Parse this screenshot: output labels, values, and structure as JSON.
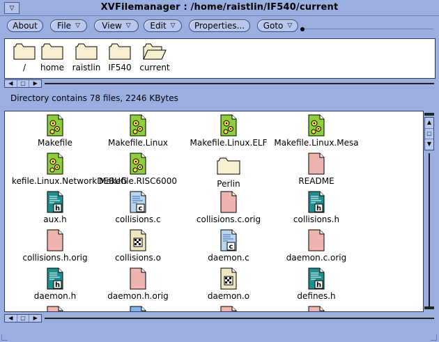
{
  "window": {
    "title": "XVFilemanager : /home/raistlin/IF540/current",
    "menu_glyph": "▽"
  },
  "menubar": [
    {
      "label": "About",
      "has_menu": false
    },
    {
      "label": "File",
      "has_menu": true
    },
    {
      "label": "View",
      "has_menu": true
    },
    {
      "label": "Edit",
      "has_menu": true
    },
    {
      "label": "Properties...",
      "has_menu": false
    },
    {
      "label": "Goto",
      "has_menu": true
    }
  ],
  "path": [
    {
      "label": "/",
      "icon": "folder-icon"
    },
    {
      "label": "home",
      "icon": "folder-icon"
    },
    {
      "label": "raistlin",
      "icon": "folder-icon"
    },
    {
      "label": "IF540",
      "icon": "folder-icon"
    },
    {
      "label": "current",
      "icon": "open-folder-icon"
    }
  ],
  "status": "Directory contains 78 files,   2246 KBytes",
  "files": [
    {
      "name": "Makefile",
      "type": "makefile"
    },
    {
      "name": "Makefile.Linux",
      "type": "makefile"
    },
    {
      "name": "Makefile.Linux.ELF",
      "type": "makefile"
    },
    {
      "name": "Makefile.Linux.Mesa",
      "type": "makefile"
    },
    {
      "name": "kefile.Linux.NetworkDEBUG",
      "type": "makefile"
    },
    {
      "name": "Makefile.RISC6000",
      "type": "makefile"
    },
    {
      "name": "Perlin",
      "type": "folder"
    },
    {
      "name": "README",
      "type": "document"
    },
    {
      "name": "aux.h",
      "type": "header"
    },
    {
      "name": "collisions.c",
      "type": "c-source"
    },
    {
      "name": "collisions.c.orig",
      "type": "document"
    },
    {
      "name": "collisions.h",
      "type": "header"
    },
    {
      "name": "collisions.h.orig",
      "type": "document"
    },
    {
      "name": "collisions.o",
      "type": "object"
    },
    {
      "name": "daemon.c",
      "type": "c-source"
    },
    {
      "name": "daemon.c.orig",
      "type": "document"
    },
    {
      "name": "daemon.h",
      "type": "header"
    },
    {
      "name": "daemon.h.orig",
      "type": "document"
    },
    {
      "name": "daemon.o",
      "type": "object"
    },
    {
      "name": "defines.h",
      "type": "header"
    },
    {
      "name": "",
      "type": "document"
    },
    {
      "name": "",
      "type": "image"
    },
    {
      "name": "",
      "type": "document"
    },
    {
      "name": "",
      "type": "document"
    }
  ],
  "colors": {
    "window_bg": "#9aaee0",
    "button_bg": "#b9c6ee",
    "makefile": "#8ccf3a",
    "header": "#1f8d8d",
    "document": "#f0b4b0",
    "c_source": "#b8d4ee",
    "object": "#f0e6c0",
    "folder": "#f6f0d0"
  }
}
